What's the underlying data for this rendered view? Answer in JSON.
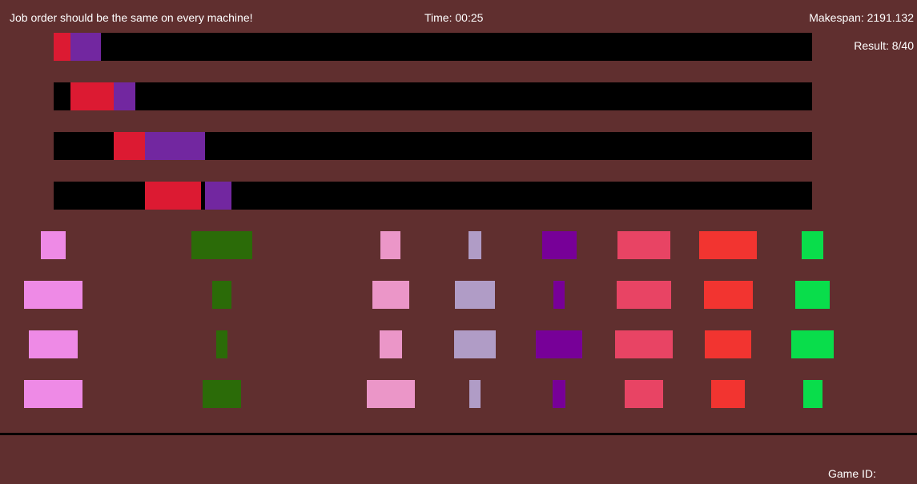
{
  "hud": {
    "message": "Job order should be the same on every machine!",
    "time_label": "Time: 00:25",
    "makespan_label": "Makespan: 2191.132",
    "result_label": "Result: 8/40",
    "game_id_label": "Game ID:"
  },
  "colors": {
    "background": "#602f2f",
    "machine_bar": "#000000",
    "red_job": "#dc1a32",
    "purple_job": "#7227a0"
  },
  "scheduled_jobs": [
    {
      "machine": 1,
      "job": "red",
      "color": "#dc1a32"
    },
    {
      "machine": 1,
      "job": "purple",
      "color": "#7227a0"
    },
    {
      "machine": 2,
      "job": "red",
      "color": "#dc1a32"
    },
    {
      "machine": 2,
      "job": "purple",
      "color": "#7227a0"
    },
    {
      "machine": 3,
      "job": "red",
      "color": "#dc1a32"
    },
    {
      "machine": 3,
      "job": "purple",
      "color": "#7227a0"
    },
    {
      "machine": 4,
      "job": "red",
      "color": "#dc1a32"
    },
    {
      "machine": 4,
      "job": "purple",
      "color": "#7227a0"
    }
  ],
  "job_columns": [
    {
      "name": "pink",
      "color": "#ee8ae6"
    },
    {
      "name": "dark-green",
      "color": "#2b6b08"
    },
    {
      "name": "light-pink",
      "color": "#eb96c8"
    },
    {
      "name": "lavender",
      "color": "#b09cc6"
    },
    {
      "name": "violet",
      "color": "#770098"
    },
    {
      "name": "rose",
      "color": "#e84464"
    },
    {
      "name": "red-orange",
      "color": "#f23430"
    },
    {
      "name": "green",
      "color": "#09dd4b"
    }
  ]
}
